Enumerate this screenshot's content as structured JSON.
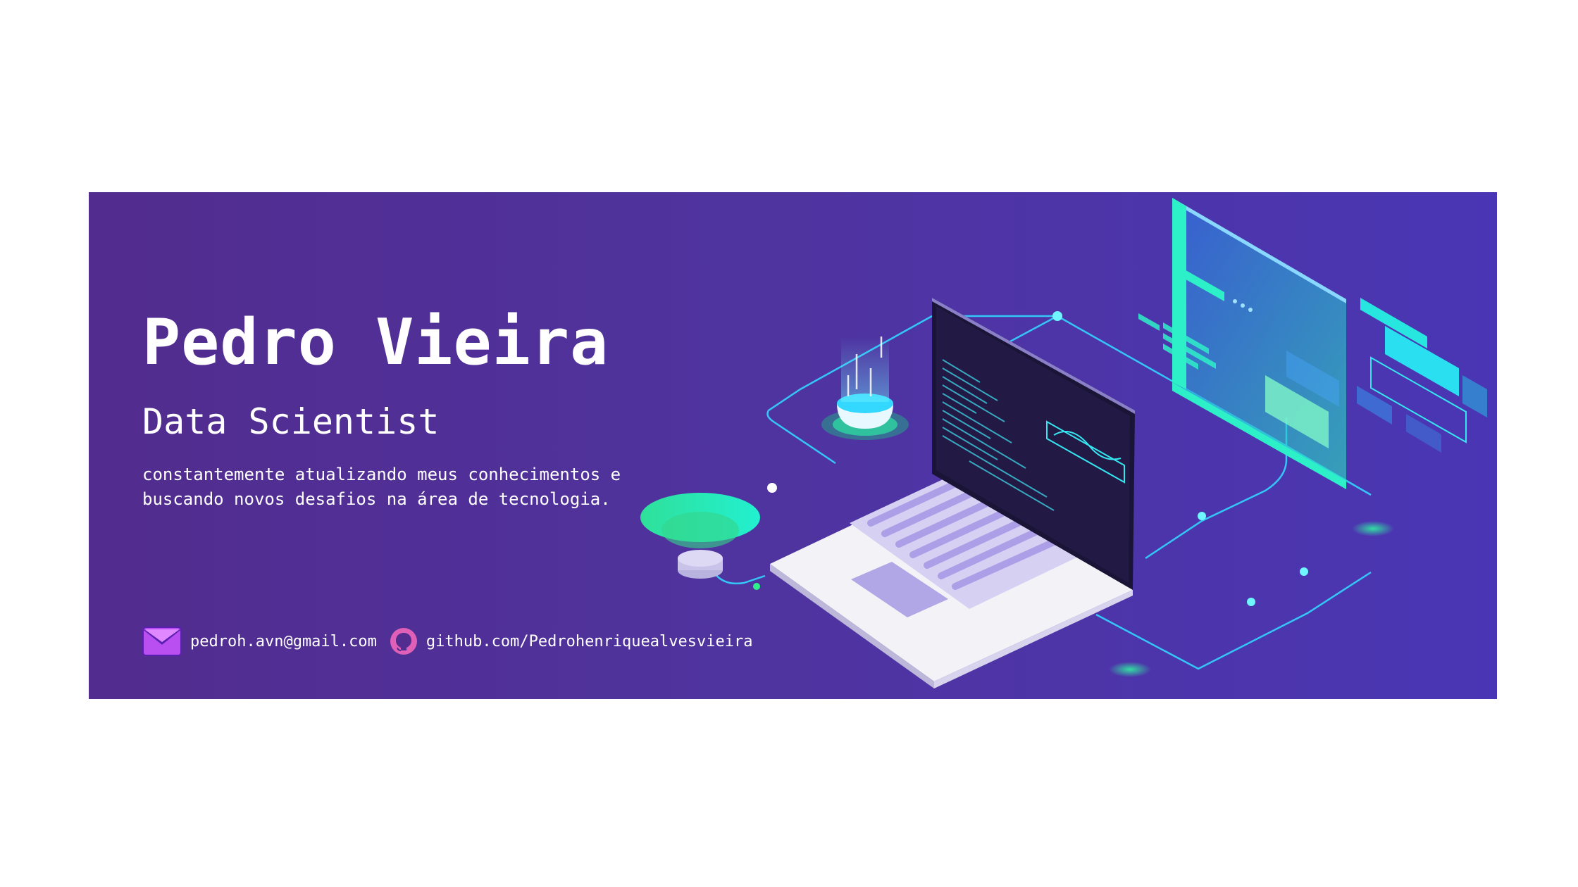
{
  "profile": {
    "name": "Pedro Vieira",
    "title": "Data Scientist",
    "description": "constantemente atualizando meus conhecimentos e buscando novos desafios na área de tecnologia."
  },
  "contacts": {
    "email": {
      "icon": "envelope-icon",
      "text": "pedroh.avn@gmail.com"
    },
    "github": {
      "icon": "github-icon",
      "text": "github.com/Pedrohenriquealvesvieira"
    }
  },
  "colors": {
    "background_start": "#522c8e",
    "background_end": "#4a36b4",
    "accent_cyan": "#2ee6f5",
    "accent_green": "#27e6a4",
    "email_icon": "#b94ff0",
    "github_icon": "#e060b8"
  }
}
